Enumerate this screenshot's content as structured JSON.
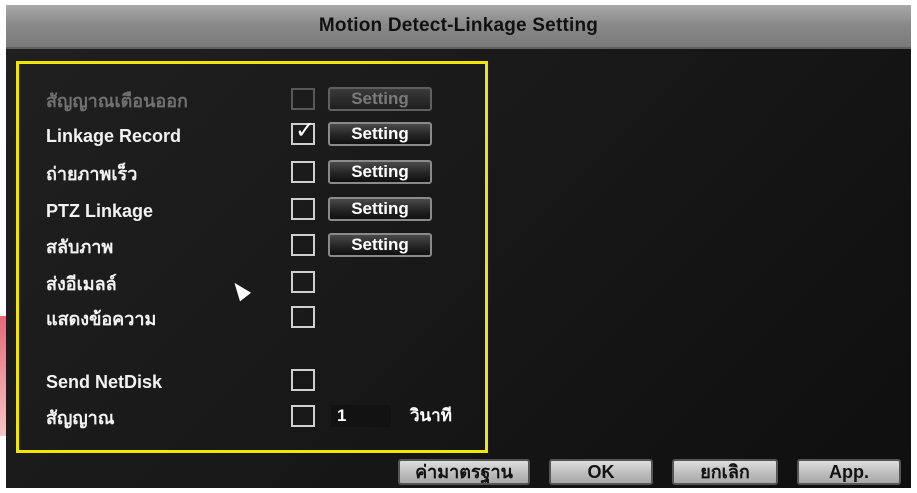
{
  "window": {
    "title": "Motion Detect-Linkage Setting"
  },
  "options": [
    {
      "label": "สัญญาณเตือนออก",
      "checked": false,
      "setting_label": "Setting",
      "enabled": false
    },
    {
      "label": "Linkage Record",
      "checked": true,
      "setting_label": "Setting",
      "enabled": true
    },
    {
      "label": "ถ่ายภาพเร็ว",
      "checked": false,
      "setting_label": "Setting",
      "enabled": true
    },
    {
      "label": "PTZ Linkage",
      "checked": false,
      "setting_label": "Setting",
      "enabled": true
    },
    {
      "label": "สลับภาพ",
      "checked": false,
      "setting_label": "Setting",
      "enabled": true
    },
    {
      "label": "ส่งอีเมลล์",
      "checked": false,
      "enabled": true
    },
    {
      "label": "แสดงข้อความ",
      "checked": false,
      "enabled": true
    },
    {
      "label": "Send NetDisk",
      "checked": false,
      "enabled": true
    },
    {
      "label": "สัญญาณ",
      "checked": false,
      "value": "1",
      "unit": "วินาที",
      "enabled": true
    }
  ],
  "check_mark": "✓",
  "footer": {
    "default_label": "ค่ามาตรฐาน",
    "ok_label": "OK",
    "cancel_label": "ยกเลิก",
    "apply_label": "App."
  },
  "colors": {
    "highlight": "#f2e600",
    "title_bar": "#8a8a8a",
    "background": "#1a1a1a"
  },
  "icons": {
    "cursor": "mouse-pointer-icon"
  }
}
